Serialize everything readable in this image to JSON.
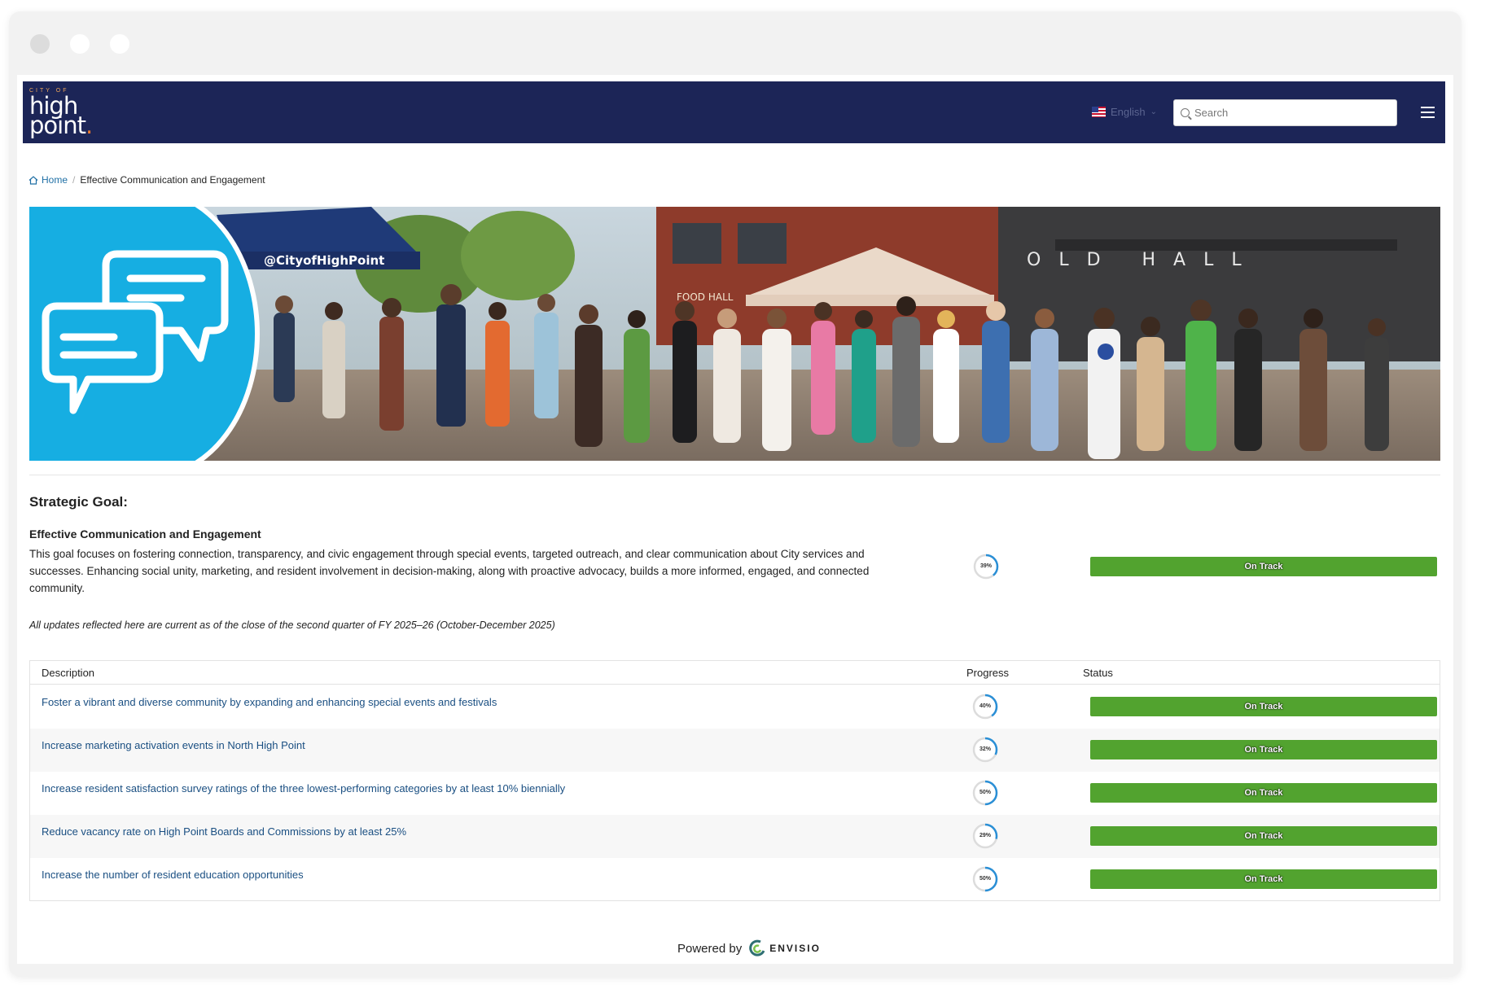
{
  "header": {
    "logo_small": "CITY OF",
    "logo_line1": "high",
    "logo_line2": "point",
    "language": "English",
    "search_placeholder": "Search"
  },
  "breadcrumb": {
    "home": "Home",
    "separator": "/",
    "current": "Effective Communication and Engagement"
  },
  "banner": {
    "tent_text": "@CityofHighPoint",
    "sign_text": "FOOD HALL",
    "building_text": "OLD HALL"
  },
  "goal": {
    "heading": "Strategic Goal:",
    "name": "Effective Communication and Engagement",
    "description": "This goal focuses on fostering connection, transparency, and civic engagement through special events, targeted outreach, and clear communication about City services and successes.  Enhancing social unity, marketing, and resident involvement in decision-making, along with proactive advocacy, builds a more informed, engaged, and connected community.",
    "progress": 39,
    "progress_label": "39%",
    "status": "On Track",
    "note": "All updates reflected here are current as of the close of the second quarter of FY 2025–26 (October-December 2025)"
  },
  "table": {
    "headers": {
      "description": "Description",
      "progress": "Progress",
      "status": "Status"
    },
    "rows": [
      {
        "description": "Foster a vibrant and diverse community by expanding and enhancing special events and festivals",
        "progress": 40,
        "progress_label": "40%",
        "status": "On Track"
      },
      {
        "description": "Increase marketing activation events in North High Point",
        "progress": 32,
        "progress_label": "32%",
        "status": "On Track"
      },
      {
        "description": "Increase resident satisfaction survey ratings of the three lowest-performing categories by at least 10% biennially",
        "progress": 50,
        "progress_label": "50%",
        "status": "On Track"
      },
      {
        "description": "Reduce vacancy rate on High Point Boards and Commissions by at least 25%",
        "progress": 29,
        "progress_label": "29%",
        "status": "On Track"
      },
      {
        "description": "Increase the number of resident education opportunities",
        "progress": 50,
        "progress_label": "50%",
        "status": "On Track"
      }
    ]
  },
  "footer": {
    "powered_by": "Powered by",
    "brand": "ENVISIO"
  },
  "colors": {
    "navbar": "#1c2557",
    "status_green": "#52a32f",
    "link_blue": "#1a4f82",
    "progress_ring": "#2a8fd6",
    "chat_blue": "#16aee2"
  }
}
